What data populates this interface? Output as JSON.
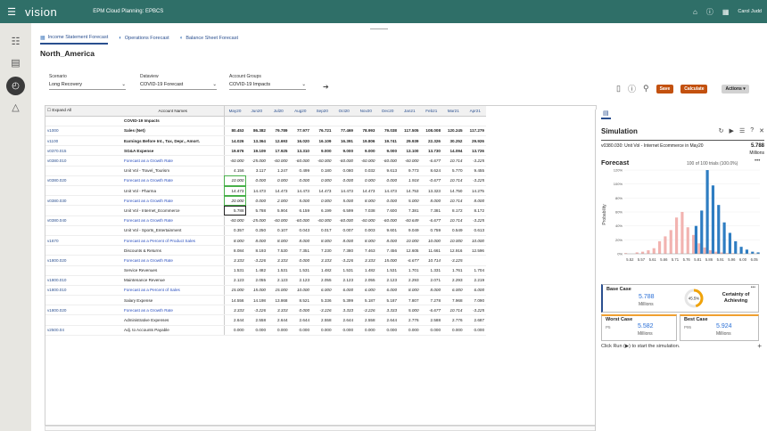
{
  "topbar": {
    "brand": "vision",
    "app_title": "EPM Cloud Planning: EPBCS",
    "user": "Carol Judd"
  },
  "tabs": [
    {
      "label": "Income Statement Forecast",
      "active": true
    },
    {
      "label": "Operations Forecast",
      "active": false
    },
    {
      "label": "Balance Sheet Forecast",
      "active": false
    }
  ],
  "page_title": "North_America",
  "pov": {
    "scenario": {
      "label": "Scenario",
      "value": "Long Recovery"
    },
    "dataview": {
      "label": "Dataview",
      "value": "COVID-19 Forecast"
    },
    "account_groups": {
      "label": "Account Groups",
      "value": "COVID-19 Impacts"
    }
  },
  "toolbar": {
    "save_label": "Save",
    "calculate_label": "Calculate",
    "actions_label": "Actions"
  },
  "grid": {
    "expand_all": "Expand All",
    "account_names_header": "Account Names",
    "columns": [
      "May20",
      "Jun20",
      "Jul20",
      "Aug20",
      "Sep20",
      "Oct20",
      "Nov20",
      "Dec20",
      "Jan21",
      "Feb21",
      "Mar21",
      "Apr21"
    ],
    "rows": [
      {
        "acct": "",
        "name": "COVID-19 Impacts",
        "style": "bold",
        "values": []
      },
      {
        "acct": "v1000",
        "name": "Sales (Net)",
        "style": "bold",
        "values": [
          "80.453",
          "86.382",
          "79.789",
          "77.977",
          "76.721",
          "77.469",
          "78.993",
          "79.038",
          "117.505",
          "108.008",
          "120.245",
          "117.279"
        ]
      },
      {
        "acct": "v1100",
        "name": "Earnings Before Int., Tax, Depr., Amort.",
        "style": "bold",
        "values": [
          "14.026",
          "13.364",
          "12.693",
          "16.020",
          "16.109",
          "16.391",
          "19.806",
          "19.741",
          "29.939",
          "22.326",
          "30.252",
          "29.926"
        ]
      },
      {
        "acct": "v0370.015",
        "name": "SG&A Expense",
        "style": "bold",
        "values": [
          "19.676",
          "19.109",
          "17.925",
          "13.310",
          "9.000",
          "9.000",
          "9.000",
          "9.000",
          "13.100",
          "13.730",
          "14.094",
          "13.726"
        ]
      },
      {
        "acct": "v0380.010",
        "name": "Forecast  as a Growth Rate",
        "style": "link",
        "ital": true,
        "values": [
          "-60.000",
          "-25.000",
          "-60.000",
          "-60.000",
          "-60.000",
          "-60.000",
          "-60.000",
          "-60.000",
          "-60.000",
          "-6.677",
          "10.714",
          "-3.225"
        ]
      },
      {
        "acct": "",
        "name": "Unit Vol - Travel_Tourism",
        "style": "normal",
        "values": [
          "4.156",
          "3.117",
          "1.247",
          "0.499",
          "0.180",
          "0.080",
          "0.032",
          "9.613",
          "9.773",
          "8.624",
          "5.770",
          "9.455"
        ]
      },
      {
        "acct": "v0380.020",
        "name": "Forecast  as a Growth Rate",
        "style": "link",
        "ital": true,
        "green": 0,
        "values": [
          "10.000",
          "0.000",
          "0.000",
          "0.000",
          "0.000",
          "0.000",
          "0.000",
          "0.000",
          "1.918",
          "-0.677",
          "10.714",
          "-3.225"
        ]
      },
      {
        "acct": "",
        "name": "Unit Vol - Pharma",
        "style": "normal",
        "green": 0,
        "values": [
          "14.473",
          "14.473",
          "14.473",
          "14.473",
          "14.473",
          "14.473",
          "14.473",
          "14.473",
          "14.753",
          "13.323",
          "14.750",
          "14.275"
        ]
      },
      {
        "acct": "v0380.030",
        "name": "Forecast  as a Growth Rate",
        "style": "link",
        "ital": true,
        "green": 0,
        "values": [
          "20.000",
          "0.000",
          "2.000",
          "5.000",
          "0.000",
          "5.000",
          "8.000",
          "0.000",
          "5.000",
          "8.000",
          "10.714",
          "8.000"
        ]
      },
      {
        "acct": "",
        "name": "Unit Vol - Internet_Ecommerce",
        "style": "normal",
        "black": 0,
        "values": [
          "5.788",
          "5.788",
          "5.904",
          "6.159",
          "6.199",
          "6.599",
          "7.038",
          "7.600",
          "7.381",
          "7.381",
          "8.172",
          "8.172"
        ]
      },
      {
        "acct": "v0380.040",
        "name": "Forecast  as a Growth Rate",
        "style": "link",
        "ital": true,
        "values": [
          "-60.000",
          "-25.000",
          "-60.000",
          "-60.000",
          "-60.000",
          "-60.000",
          "-60.000",
          "-60.000",
          "-60.649",
          "-6.677",
          "10.714",
          "-3.225"
        ]
      },
      {
        "acct": "",
        "name": "Unit Vol - Sports_Entertainment",
        "style": "normal",
        "values": [
          "0.357",
          "0.250",
          "0.107",
          "0.043",
          "0.017",
          "0.007",
          "0.003",
          "9.601",
          "9.049",
          "0.759",
          "0.549",
          "0.613"
        ]
      },
      {
        "acct": "v1670",
        "name": "Forecast  as a Percent of Product Sales",
        "style": "link",
        "ital": true,
        "values": [
          "8.000",
          "8.000",
          "8.000",
          "8.000",
          "8.000",
          "8.000",
          "8.000",
          "8.000",
          "10.000",
          "10.000",
          "10.000",
          "10.000"
        ]
      },
      {
        "acct": "",
        "name": "Discounts & Returns",
        "style": "normal",
        "values": [
          "8.084",
          "8.193",
          "7.530",
          "7.351",
          "7.230",
          "7.380",
          "7.463",
          "7.456",
          "12.605",
          "11.661",
          "12.916",
          "12.596"
        ]
      },
      {
        "acct": "v1800.020",
        "name": "Forecast  as a Growth Rate",
        "style": "link",
        "ital": true,
        "values": [
          "3.333",
          "-3.226",
          "3.333",
          "0.000",
          "3.333",
          "-3.226",
          "3.333",
          "15.000",
          "-6.677",
          "10.714",
          "-3.225",
          ""
        ]
      },
      {
        "acct": "",
        "name": "Service Revenues",
        "style": "normal",
        "values": [
          "1.531",
          "1.482",
          "1.531",
          "1.531",
          "1.482",
          "1.531",
          "1.482",
          "1.531",
          "1.701",
          "1.331",
          "1.761",
          "1.704"
        ]
      },
      {
        "acct": "v1800.010",
        "name": "Maintenance Revenue",
        "style": "normal",
        "values": [
          "2.123",
          "2.055",
          "2.123",
          "2.123",
          "2.055",
          "2.123",
          "2.055",
          "2.123",
          "2.293",
          "2.071",
          "2.293",
          "2.219"
        ]
      },
      {
        "acct": "v1800.010",
        "name": "Forecast  as a Percent of Sales",
        "style": "link",
        "ital": true,
        "values": [
          "15.000",
          "15.000",
          "15.000",
          "10.000",
          "6.000",
          "6.000",
          "6.000",
          "6.000",
          "8.000",
          "8.000",
          "6.000",
          "6.000"
        ]
      },
      {
        "acct": "",
        "name": "Salary Expense",
        "style": "normal",
        "values": [
          "14.556",
          "14.198",
          "13.868",
          "8.521",
          "5.336",
          "5.399",
          "5.187",
          "5.187",
          "7.807",
          "7.278",
          "7.968",
          "7.090"
        ]
      },
      {
        "acct": "v1800.020",
        "name": "Forecast  as a Growth Rate",
        "style": "link",
        "ital": true,
        "values": [
          "3.333",
          "-3.226",
          "3.333",
          "0.000",
          "-3.226",
          "3.333",
          "-3.226",
          "3.333",
          "5.000",
          "-6.677",
          "10.714",
          "-3.225"
        ]
      },
      {
        "acct": "",
        "name": "Administrative Expenses",
        "style": "normal",
        "values": [
          "2.644",
          "2.558",
          "2.644",
          "2.644",
          "2.558",
          "2.644",
          "2.558",
          "2.644",
          "2.776",
          "2.588",
          "2.776",
          "2.687"
        ]
      },
      {
        "acct": "v2500.04",
        "name": "Adj. to Accounts Payable",
        "style": "normal",
        "values": [
          "0.000",
          "0.000",
          "0.000",
          "0.000",
          "0.000",
          "0.000",
          "0.000",
          "0.000",
          "0.000",
          "0.000",
          "0.000",
          "0.000"
        ]
      }
    ]
  },
  "simulation": {
    "title": "Simulation",
    "variable": "v0380.030: Unit Vol - Internet Ecommerce in May20",
    "value": "5.788",
    "unit": "Millions",
    "forecast_title": "Forecast",
    "trials_text": "100 of 100 trials (100.0%)",
    "y_axis_label": "Probability",
    "y_ticks": [
      "0%",
      "20%",
      "40%",
      "60%",
      "80%",
      "100%",
      "120%"
    ],
    "x_ticks": [
      "5.52",
      "5.57",
      "5.61",
      "5.66",
      "5.71",
      "5.76",
      "5.81",
      "5.86",
      "5.91",
      "5.96",
      "6.00",
      "6.05"
    ],
    "base_case": {
      "label": "Base Case",
      "value": "5.788",
      "unit": "Millions",
      "certainty": "45.5%",
      "certainty_label": "Certainty of Achieving"
    },
    "worst_case": {
      "label": "Worst Case",
      "value": "5.582",
      "unit": "Millions",
      "percentile": "P5"
    },
    "best_case": {
      "label": "Best Case",
      "value": "5.924",
      "unit": "Millions",
      "percentile": "P95"
    },
    "note": "Click Run (▶) to start the simulation."
  },
  "chart_data": {
    "type": "bar",
    "categories": [
      "5.52",
      "5.57",
      "5.61",
      "5.66",
      "5.71",
      "5.76",
      "5.81",
      "5.86",
      "5.91",
      "5.96",
      "6.00",
      "6.05"
    ],
    "ylim": [
      0,
      120
    ],
    "series": [
      {
        "values": [
          1,
          0,
          2,
          3,
          5,
          8,
          18,
          25,
          34,
          52,
          60,
          38,
          27,
          15,
          9,
          5,
          3,
          2,
          1,
          1,
          0,
          0,
          0,
          0
        ],
        "color": "#f2b3b0"
      },
      {
        "values": [
          0,
          0,
          0,
          0,
          0,
          0,
          0,
          0,
          0,
          0,
          0,
          0,
          40,
          62,
          120,
          98,
          70,
          45,
          30,
          18,
          10,
          6,
          3,
          2
        ],
        "color": "#2e7dc2"
      }
    ]
  }
}
